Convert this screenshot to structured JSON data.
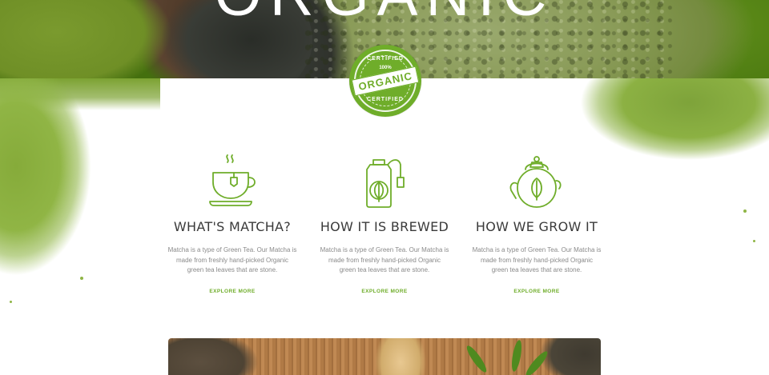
{
  "hero": {
    "title": "ORGANIC"
  },
  "badge": {
    "top_text": "CERTIFIED",
    "percent_text": "100%",
    "main_text": "ORGANIC",
    "bottom_text": "CERTIFIED"
  },
  "features": [
    {
      "icon": "teacup-icon",
      "title": "WHAT'S MATCHA?",
      "text": "Matcha is a type of Green Tea. Our Matcha is made from freshly hand-picked Organic green tea leaves that are stone.",
      "link": "EXPLORE MORE"
    },
    {
      "icon": "teabag-icon",
      "title": "HOW IT IS BREWED",
      "text": "Matcha is a type of Green Tea. Our Matcha is made from freshly hand-picked Organic green tea leaves that are stone.",
      "link": "EXPLORE MORE"
    },
    {
      "icon": "teapot-icon",
      "title": "HOW WE GROW IT",
      "text": "Matcha is a type of Green Tea. Our Matcha is made from freshly hand-picked Organic green tea leaves that are stone.",
      "link": "EXPLORE MORE"
    }
  ],
  "colors": {
    "accent": "#6fad2a",
    "heading": "#3a3a3a",
    "body_text": "#8a8a8a"
  }
}
